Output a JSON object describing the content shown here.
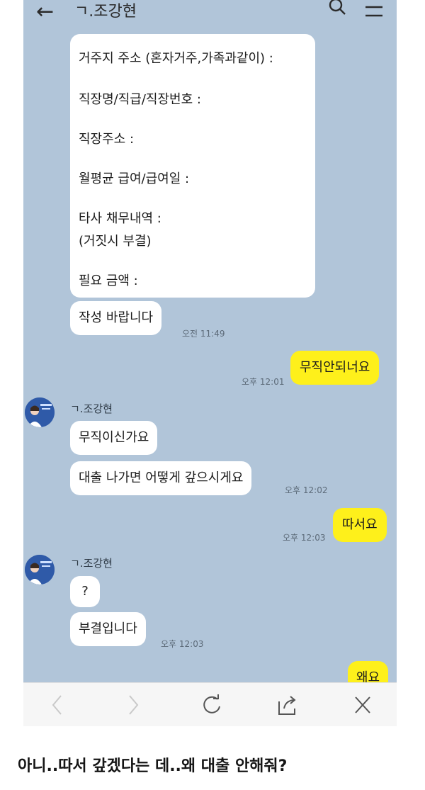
{
  "header": {
    "title": "ㄱ.조강현"
  },
  "form": {
    "lines": [
      "거주지 주소 (혼자거주,가족과같이) :",
      "직장명/직급/직장번호 :",
      "직장주소 :",
      "월평균 급여/급여일 :",
      "타사 채무내역 :",
      "(거짓시 부결)",
      "필요 금액 :"
    ]
  },
  "messages": {
    "m1": {
      "text": "작성 바랍니다",
      "time": "오전 11:49"
    },
    "m2": {
      "text": "무직안되너요",
      "time": "오후 12:01"
    },
    "sender": "ㄱ.조강현",
    "m3": {
      "text": "무직이신가요"
    },
    "m4": {
      "text": "대출 나가면 어떻게 갚으시게요",
      "time": "오후 12:02"
    },
    "m5": {
      "text": "따서요",
      "time": "오후 12:03"
    },
    "m6": {
      "text": "?"
    },
    "m7": {
      "text": "부결입니다",
      "time": "오후 12:03"
    },
    "m8": {
      "text": "왜요"
    }
  },
  "caption": "아니..따서 갚겠다는 데..왜 대출 안해줘?",
  "colors": {
    "chat_bg": "#b1c5d9",
    "my_bubble": "#fef01b",
    "other_bubble": "#ffffff"
  },
  "icons": [
    "back-arrow-icon",
    "search-icon",
    "menu-icon",
    "browser-back-icon",
    "browser-forward-icon",
    "reload-icon",
    "share-icon",
    "close-icon"
  ]
}
